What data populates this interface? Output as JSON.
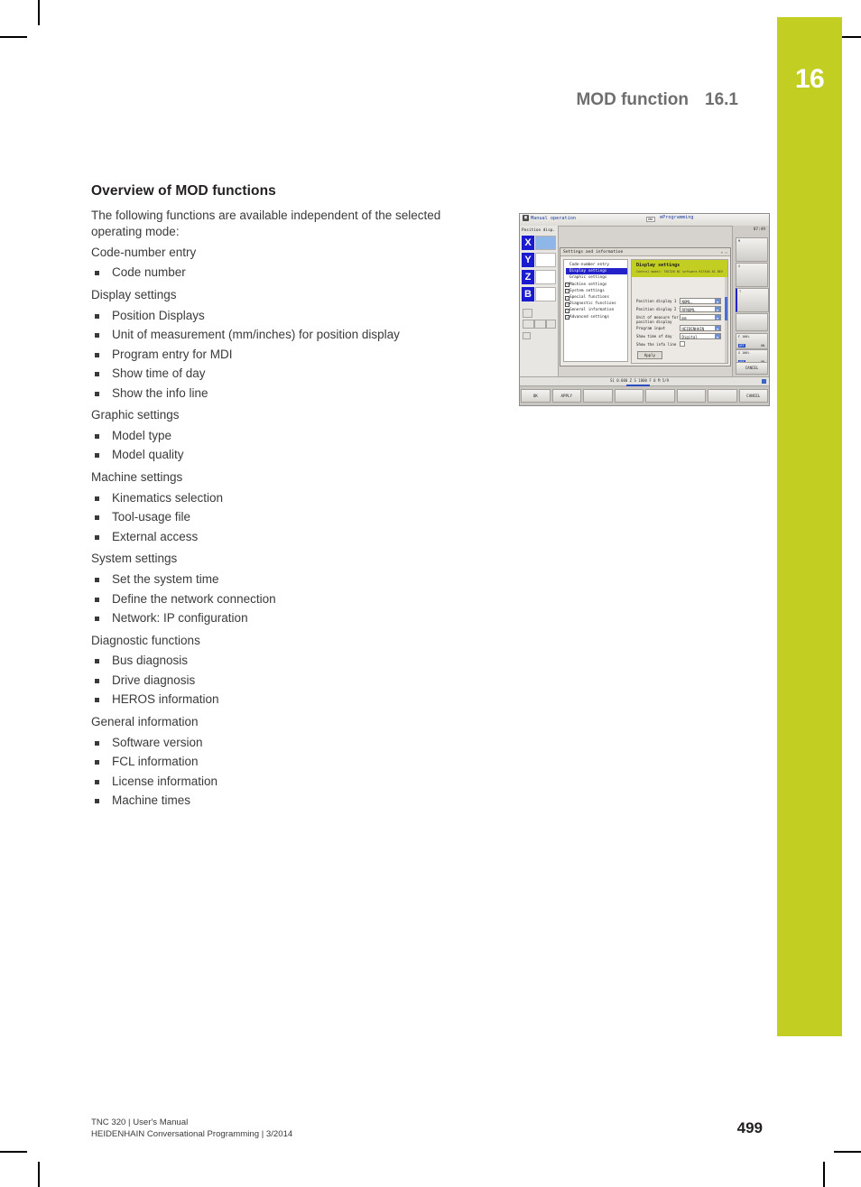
{
  "chapter": {
    "number": "16"
  },
  "running_head": {
    "title": "MOD function",
    "section": "16.1"
  },
  "content": {
    "section_title": "Overview of MOD functions",
    "intro": "The following functions are available independent of the selected operating mode:",
    "groups": [
      {
        "heading": "Code-number entry",
        "items": [
          "Code number"
        ]
      },
      {
        "heading": "Display settings",
        "items": [
          "Position Displays",
          "Unit of measurement (mm/inches) for position display",
          "Program entry for MDI",
          "Show time of day",
          "Show the info line"
        ]
      },
      {
        "heading": "Graphic settings",
        "items": [
          "Model type",
          "Model quality"
        ]
      },
      {
        "heading": "Machine settings",
        "items": [
          "Kinematics selection",
          "Tool-usage file",
          "External access"
        ]
      },
      {
        "heading": "System settings",
        "items": [
          "Set the system time",
          "Define the network connection",
          "Network: IP configuration"
        ]
      },
      {
        "heading": "Diagnostic functions",
        "items": [
          "Bus diagnosis",
          "Drive diagnosis",
          "HEROS information"
        ]
      },
      {
        "heading": "General information",
        "items": [
          "Software version",
          "FCL information",
          "License information",
          "Machine times"
        ]
      }
    ]
  },
  "figure": {
    "status_bar": {
      "mode_left": "Manual operation",
      "mode_right": "Programming",
      "dnc_badge": "DNC",
      "clock": "07:49"
    },
    "left_panel": {
      "header": "Position disp.",
      "axes": [
        "X",
        "Y",
        "Z",
        "B"
      ]
    },
    "dialog": {
      "title": "Settings and information",
      "tree": [
        "Code-number entry",
        "Display settings",
        "Graphic settings",
        "Machine settings",
        "System settings",
        "Special functions",
        "Diagnostic functions",
        "General information",
        "Advanced settings"
      ],
      "selected_tree_index": 1,
      "pane_title": "Display settings",
      "pane_subtitle": "Control model: TNC320 NC software  617404-01 DEV",
      "fields": [
        {
          "label": "Position display 1",
          "value": "NOML.",
          "type": "select"
        },
        {
          "label": "Position display 2",
          "value": "RFNOML",
          "type": "select"
        },
        {
          "label": "Unit of measure for",
          "label2": "position display",
          "value": "mm",
          "type": "select"
        },
        {
          "label": "Program input",
          "value": "HEIDENHAIN",
          "type": "select"
        },
        {
          "label": "Show time of day",
          "value": "Digital",
          "type": "select"
        },
        {
          "label": "Show the info line",
          "value": "",
          "type": "checkbox"
        }
      ],
      "apply_button": "Apply"
    },
    "right_panel": {
      "feed_override": {
        "percent": "F 100%",
        "off": "OFF",
        "on": "ON"
      },
      "spindle_override": {
        "percent": "S 100%",
        "off": "OFF",
        "on": "ON"
      },
      "cancel_label": "CANCEL"
    },
    "status_line": "S1  0.000  Z  S 1800  F 0  M 5/9",
    "softkeys": [
      "OK",
      "APPLY",
      "",
      "",
      "",
      "",
      "",
      "CANCEL"
    ]
  },
  "footer": {
    "line1": "TNC 320 | User's Manual",
    "line2": "HEIDENHAIN Conversational Programming | 3/2014",
    "page": "499"
  }
}
